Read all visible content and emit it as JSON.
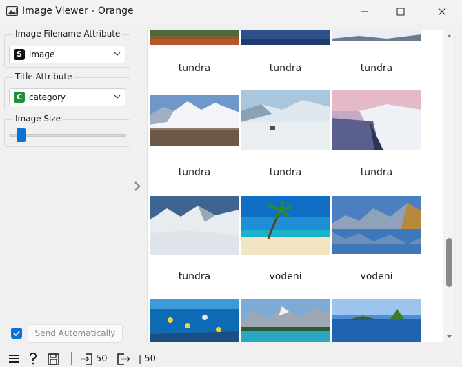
{
  "window": {
    "title": "Image Viewer - Orange",
    "icons": [
      "image-viewer-app-icon",
      "minimize-icon",
      "maximize-icon",
      "close-icon"
    ]
  },
  "sidebar": {
    "filename_attr": {
      "label": "Image Filename Attribute",
      "type_badge": "S",
      "badge_color": "#111111",
      "value": "image"
    },
    "title_attr": {
      "label": "Title Attribute",
      "type_badge": "C",
      "badge_color": "#1e8f3a",
      "value": "category"
    },
    "image_size": {
      "label": "Image Size",
      "level_fraction": 0.08
    },
    "send": {
      "checked": true,
      "label": "Send Automatically"
    }
  },
  "gallery": {
    "rows": [
      {
        "images": [
          {
            "scene": "tundra-red-field"
          },
          {
            "scene": "tundra-blue-water"
          },
          {
            "scene": "tundra-snow-rocks"
          }
        ],
        "captions": [
          "tundra",
          "tundra",
          "tundra"
        ]
      },
      {
        "images": [
          {
            "scene": "tundra-mountains-herd"
          },
          {
            "scene": "tundra-snowfield-wolf"
          },
          {
            "scene": "tundra-pink-coast"
          }
        ],
        "captions": [
          "tundra",
          "tundra",
          "tundra"
        ]
      },
      {
        "images": [
          {
            "scene": "tundra-snowy-peaks"
          },
          {
            "scene": "vodeni-palm-beach"
          },
          {
            "scene": "vodeni-mountain-lake"
          }
        ],
        "captions": [
          "tundra",
          "vodeni",
          "vodeni"
        ]
      },
      {
        "images": [
          {
            "scene": "coral-reef-fish"
          },
          {
            "scene": "mountain-lake-forest"
          },
          {
            "scene": "blue-bay-island"
          }
        ],
        "captions": []
      }
    ]
  },
  "statusbar": {
    "input_count": "50",
    "output_text": "- | 50"
  },
  "colors": {
    "accent": "#0a74d6"
  }
}
